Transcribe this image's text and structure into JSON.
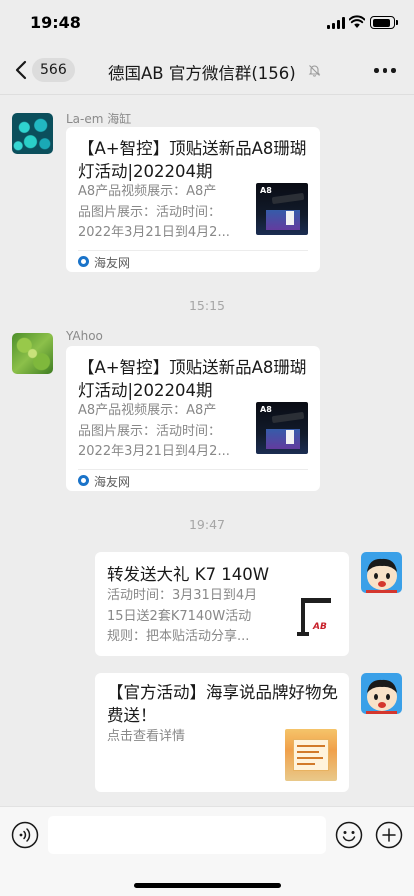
{
  "status_bar": {
    "time": "19:48"
  },
  "nav": {
    "back_count": "566",
    "title": "德国AB  官方微信群(156)",
    "icons": {
      "back": "chevron-left-icon",
      "mute": "bell-off-icon",
      "more": "more-dots-icon"
    }
  },
  "messages": [
    {
      "sender": "La-em 海缸",
      "direction": "incoming",
      "avatar": "coral-avatar",
      "card": {
        "title": "【A+智控】顶贴送新品A8珊瑚灯活动|202204期",
        "desc_lines": [
          "A8产品视频展示：A8产",
          "品图片展示：活动时间：",
          "2022年3月21日到4月2..."
        ],
        "thumb_label": "A8",
        "source": "海友网"
      }
    },
    {
      "timestamp": "15:15"
    },
    {
      "sender": "YAhoo",
      "direction": "incoming",
      "avatar": "leaf-avatar",
      "card": {
        "title": "【A+智控】顶贴送新品A8珊瑚灯活动|202204期",
        "desc_lines": [
          "A8产品视频展示：A8产",
          "品图片展示：活动时间：",
          "2022年3月21日到4月2..."
        ],
        "thumb_label": "A8",
        "source": "海友网"
      }
    },
    {
      "timestamp": "19:47"
    },
    {
      "direction": "outgoing",
      "avatar": "cartoon-avatar",
      "card": {
        "title": "转发送大礼 K7 140W",
        "desc_lines": [
          "活动时间：3月31日到4月",
          "15日送2套K7140W活动",
          "规则：把本贴活动分享..."
        ],
        "thumb_logo": "AB"
      }
    },
    {
      "direction": "outgoing",
      "avatar": "cartoon-avatar",
      "card": {
        "title": "【官方活动】海享说品牌好物免费送！",
        "desc_lines": [
          "点击查看详情"
        ]
      }
    }
  ],
  "input_bar": {
    "placeholder": "",
    "icons": {
      "voice": "voice-icon",
      "emoji": "emoji-icon",
      "plus": "plus-icon"
    }
  },
  "colors": {
    "background": "#ededed",
    "card": "#ffffff",
    "source_icon": "#1a73c9",
    "avatar_bg": "#3aa0e8"
  }
}
